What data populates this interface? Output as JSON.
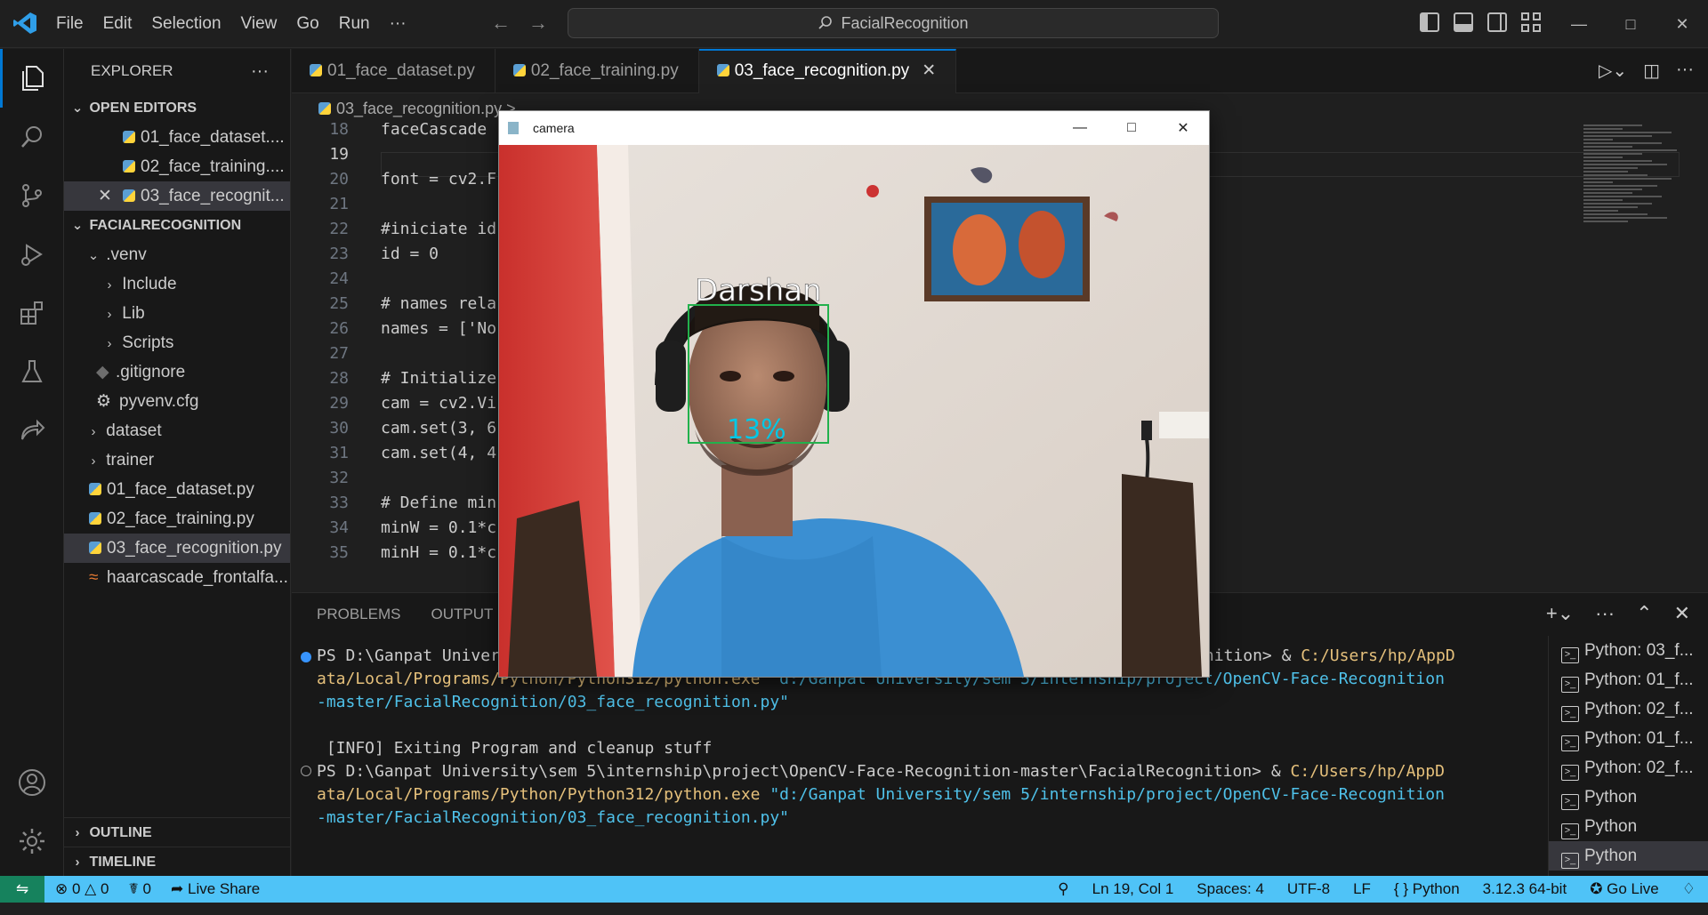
{
  "menu": [
    "File",
    "Edit",
    "Selection",
    "View",
    "Go",
    "Run",
    "···"
  ],
  "command_center": "FacialRecognition",
  "sidebar": {
    "title": "EXPLORER",
    "open_editors_label": "OPEN EDITORS",
    "open_editors": [
      "01_face_dataset....",
      "02_face_training....",
      "03_face_recognit..."
    ],
    "project_label": "FACIALRECOGNITION",
    "tree": {
      "venv": ".venv",
      "include": "Include",
      "lib": "Lib",
      "scripts": "Scripts",
      "gitignore": ".gitignore",
      "pyvenv": "pyvenv.cfg",
      "dataset": "dataset",
      "trainer": "trainer",
      "f1": "01_face_dataset.py",
      "f2": "02_face_training.py",
      "f3": "03_face_recognition.py",
      "f4": "haarcascade_frontalfa..."
    },
    "outline_label": "OUTLINE",
    "timeline_label": "TIMELINE"
  },
  "tabs": [
    "01_face_dataset.py",
    "02_face_training.py",
    "03_face_recognition.py"
  ],
  "breadcrumb": "03_face_recognition.py >",
  "code": [
    {
      "n": "18",
      "t": "faceCascade"
    },
    {
      "n": "19",
      "t": ""
    },
    {
      "n": "20",
      "t": "font = cv2.F"
    },
    {
      "n": "21",
      "t": ""
    },
    {
      "n": "22",
      "t": "#iniciate id"
    },
    {
      "n": "23",
      "t": "id = 0"
    },
    {
      "n": "24",
      "t": ""
    },
    {
      "n": "25",
      "t": "# names rela"
    },
    {
      "n": "26",
      "t": "names = ['No"
    },
    {
      "n": "27",
      "t": ""
    },
    {
      "n": "28",
      "t": "# Initialize"
    },
    {
      "n": "29",
      "t": "cam = cv2.Vi"
    },
    {
      "n": "30",
      "t": "cam.set(3, 6"
    },
    {
      "n": "31",
      "t": "cam.set(4, 4"
    },
    {
      "n": "32",
      "t": ""
    },
    {
      "n": "33",
      "t": "# Define min"
    },
    {
      "n": "34",
      "t": "minW = 0.1*c"
    },
    {
      "n": "35",
      "t": "minH = 0.1*c"
    }
  ],
  "panel": {
    "tabs": [
      "PROBLEMS",
      "OUTPUT"
    ],
    "terminal": {
      "l1a": "PS D:\\Ganpat Univer",
      "l1b": "nition> & ",
      "l1c": "C:/Users/hp/AppD",
      "l2a": "ata/Local/Programs/Python/Python312/python.exe",
      "l2b": " \"d:/Ganpat University/sem 5/internship/project/OpenCV-Face-Recognition",
      "l3": "-master/FacialRecognition/03_face_recognition.py\"",
      "l4": " [INFO] Exiting Program and cleanup stuff",
      "l5a": "PS D:\\Ganpat University\\sem 5\\internship\\project\\OpenCV-Face-Recognition-master\\FacialRecognition> & ",
      "l5b": "C:/Users/hp/AppD",
      "l6a": "ata/Local/Programs/Python/Python312/python.exe",
      "l6b": " \"d:/Ganpat University/sem 5/internship/project/OpenCV-Face-Recognition",
      "l7": "-master/FacialRecognition/03_face_recognition.py\""
    },
    "terminals": [
      "Python: 03_f...",
      "Python: 01_f...",
      "Python: 02_f...",
      "Python: 01_f...",
      "Python: 02_f...",
      "Python",
      "Python",
      "Python"
    ]
  },
  "status": {
    "errors": "0",
    "warnings": "0",
    "ports": "0",
    "live_share": "Live Share",
    "position": "Ln 19, Col 1",
    "spaces": "Spaces: 4",
    "encoding": "UTF-8",
    "eol": "LF",
    "language": "Python",
    "interpreter": "3.12.3 64-bit",
    "go_live": "Go Live"
  },
  "camera": {
    "title": "camera",
    "name": "Darshan",
    "confidence": "13%"
  },
  "colors": {
    "accent": "#0078d4",
    "statusbar": "#4fc3f7",
    "remote": "#16825d",
    "face_box": "#22b14c",
    "confidence_text": "#00c8e6"
  }
}
